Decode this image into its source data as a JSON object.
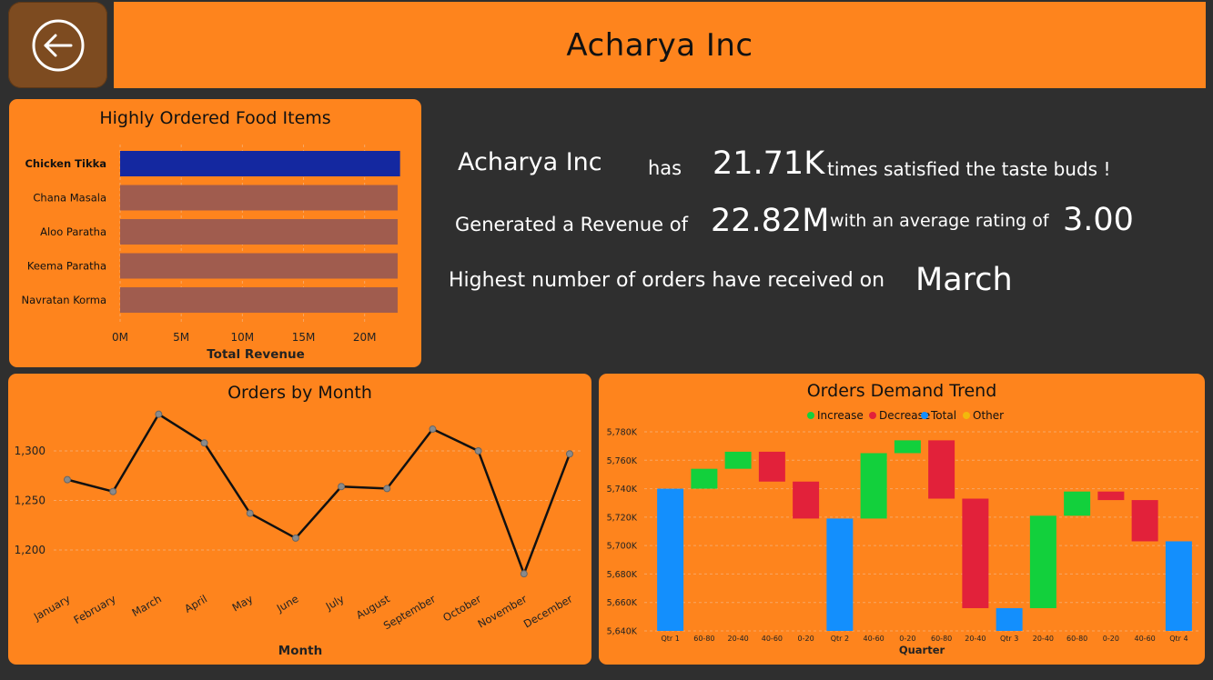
{
  "header": {
    "title": "Acharya Inc",
    "back_icon": "arrow-left-circle-icon"
  },
  "kpis": {
    "company": "Acharya Inc",
    "has": "has",
    "satisfied_count": "21.71K",
    "satisfied_text": "times satisfied the taste buds !",
    "revenue_prefix": "Generated a Revenue of",
    "revenue_value": "22.82M",
    "rating_prefix": "with an average rating of",
    "rating_value": "3.00",
    "orders_text": "Highest number of orders have received on",
    "orders_month": "March"
  },
  "colors": {
    "background": "#2f2f2f",
    "card": "#fe841d",
    "bar_highlight": "#1428a0",
    "bar_default": "#a05c4e",
    "increase": "#12d03c",
    "decrease": "#e2213a",
    "total": "#138ffd",
    "other": "#f2b80c"
  },
  "chart_data": [
    {
      "type": "bar",
      "orientation": "horizontal",
      "title": "Highly Ordered Food Items",
      "categories": [
        "Chicken Tikka",
        "Chana Masala",
        "Aloo Paratha",
        "Keema Paratha",
        "Navratan Korma"
      ],
      "values": [
        22.9,
        22.7,
        22.7,
        22.7,
        22.7
      ],
      "highlighted": "Chicken Tikka",
      "xlabel": "Total Revenue",
      "ylabel": "",
      "xlim": [
        0,
        23
      ],
      "xticks": [
        "0M",
        "5M",
        "10M",
        "15M",
        "20M"
      ],
      "xtick_values": [
        0,
        5,
        10,
        15,
        20
      ],
      "grid": true
    },
    {
      "type": "line",
      "title": "Orders by Month",
      "categories": [
        "January",
        "February",
        "March",
        "April",
        "May",
        "June",
        "July",
        "August",
        "September",
        "October",
        "November",
        "December"
      ],
      "values": [
        1271,
        1259,
        1337,
        1308,
        1237,
        1212,
        1264,
        1262,
        1322,
        1300,
        1176,
        1297
      ],
      "xlabel": "Month",
      "ylabel": "",
      "ylim": [
        1150,
        1350
      ],
      "yticks": [
        "1,200",
        "1,250",
        "1,300"
      ],
      "ytick_values": [
        1200,
        1250,
        1300
      ],
      "grid": true
    },
    {
      "type": "waterfall",
      "title": "Orders Demand Trend",
      "legend": [
        "Increase",
        "Decrease",
        "Total",
        "Other"
      ],
      "legend_position": "top-center",
      "xlabel": "Quarter",
      "ylabel": "",
      "ylim": [
        5640,
        5785
      ],
      "yticks": [
        "5,640K",
        "5,660K",
        "5,680K",
        "5,700K",
        "5,720K",
        "5,740K",
        "5,760K",
        "5,780K"
      ],
      "ytick_values": [
        5640,
        5660,
        5680,
        5700,
        5720,
        5740,
        5760,
        5780
      ],
      "grid": true,
      "bars": [
        {
          "label": "Qtr 1",
          "kind": "total",
          "start": 5640,
          "end": 5740
        },
        {
          "label": "60-80",
          "kind": "increase",
          "start": 5740,
          "end": 5754
        },
        {
          "label": "20-40",
          "kind": "increase",
          "start": 5754,
          "end": 5766
        },
        {
          "label": "40-60",
          "kind": "decrease",
          "start": 5766,
          "end": 5745
        },
        {
          "label": "0-20",
          "kind": "decrease",
          "start": 5745,
          "end": 5719
        },
        {
          "label": "Qtr 2",
          "kind": "total",
          "start": 5640,
          "end": 5719
        },
        {
          "label": "40-60",
          "kind": "increase",
          "start": 5719,
          "end": 5765
        },
        {
          "label": "0-20",
          "kind": "increase",
          "start": 5765,
          "end": 5774
        },
        {
          "label": "60-80",
          "kind": "decrease",
          "start": 5774,
          "end": 5733
        },
        {
          "label": "20-40",
          "kind": "decrease",
          "start": 5733,
          "end": 5656
        },
        {
          "label": "Qtr 3",
          "kind": "total",
          "start": 5640,
          "end": 5656
        },
        {
          "label": "20-40",
          "kind": "increase",
          "start": 5656,
          "end": 5721
        },
        {
          "label": "60-80",
          "kind": "increase",
          "start": 5721,
          "end": 5738
        },
        {
          "label": "0-20",
          "kind": "decrease",
          "start": 5738,
          "end": 5732
        },
        {
          "label": "40-60",
          "kind": "decrease",
          "start": 5732,
          "end": 5703
        },
        {
          "label": "Qtr 4",
          "kind": "total",
          "start": 5640,
          "end": 5703
        }
      ]
    }
  ]
}
